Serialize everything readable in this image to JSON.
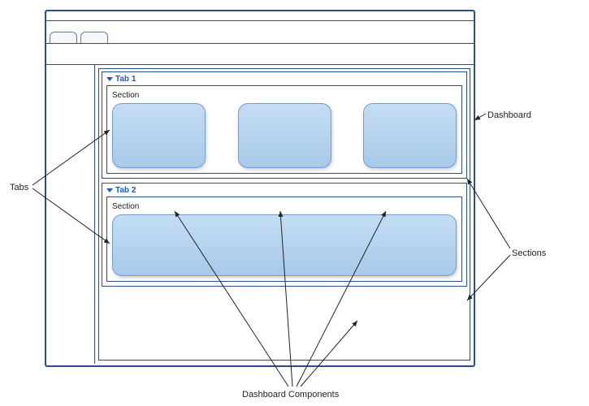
{
  "dashboard": {
    "tabs": [
      {
        "label": "Tab 1",
        "section": {
          "title": "Section",
          "components": [
            {
              "kind": "small"
            },
            {
              "kind": "small"
            },
            {
              "kind": "small"
            }
          ]
        }
      },
      {
        "label": "Tab 2",
        "section": {
          "title": "Section",
          "components": [
            {
              "kind": "wide"
            }
          ]
        }
      }
    ]
  },
  "callouts": {
    "tabs": "Tabs",
    "dashboard": "Dashboard",
    "sections": "Sections",
    "dashboard_components": "Dashboard Components"
  }
}
